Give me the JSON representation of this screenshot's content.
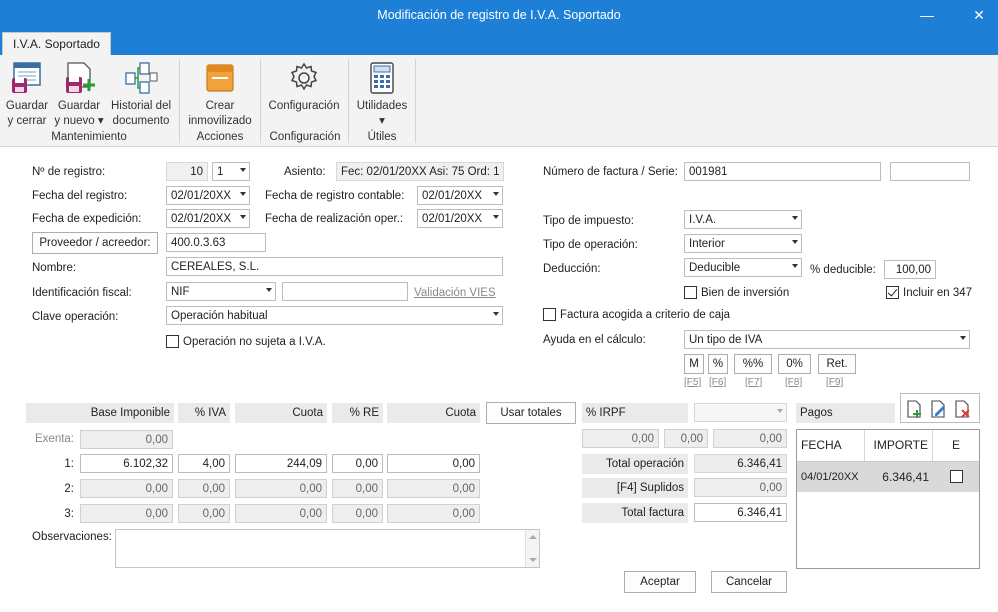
{
  "window": {
    "title": "Modificación de registro de I.V.A. Soportado"
  },
  "tab": {
    "label": "I.V.A. Soportado"
  },
  "ribbon": {
    "buttons": [
      {
        "label1": "Guardar",
        "label2": "y cerrar"
      },
      {
        "label1": "Guardar",
        "label2": "y nuevo ▾"
      },
      {
        "label1": "Historial del",
        "label2": "documento"
      },
      {
        "label1": "Crear",
        "label2": "inmovilizado"
      },
      {
        "label1": "Configuración",
        "label2": ""
      },
      {
        "label1": "Utilidades",
        "label2": "▾"
      }
    ],
    "groups": [
      "Mantenimiento",
      "Acciones",
      "Configuración",
      "Útiles"
    ]
  },
  "form": {
    "num_registro_label": "Nº de registro:",
    "num_registro_value": "10",
    "num_registro_sub": "1",
    "asiento_label": "Asiento:",
    "asiento_value": "Fec: 02/01/20XX Asi: 75 Ord: 1",
    "fecha_registro_label": "Fecha del registro:",
    "fecha_registro_value": "02/01/20XX",
    "fecha_contable_label": "Fecha de registro contable:",
    "fecha_contable_value": "02/01/20XX",
    "fecha_expedicion_label": "Fecha de expedición:",
    "fecha_expedicion_value": "02/01/20XX",
    "fecha_realizacion_label": "Fecha de realización oper.:",
    "fecha_realizacion_value": "02/01/20XX",
    "proveedor_button": "Proveedor / acreedor:",
    "proveedor_value": "400.0.3.63",
    "nombre_label": "Nombre:",
    "nombre_value": "CEREALES, S.L.",
    "identificacion_label": "Identificación fiscal:",
    "identificacion_tipo": "NIF",
    "identificacion_value": "",
    "validacion_link": "Validación VIES",
    "clave_label": "Clave operación:",
    "clave_value": "Operación habitual",
    "no_sujeta_label": "Operación no sujeta a I.V.A.",
    "num_factura_label": "Número de factura / Serie:",
    "num_factura_value": "001981",
    "serie_value": "",
    "tipo_impuesto_label": "Tipo de impuesto:",
    "tipo_impuesto_value": "I.V.A.",
    "tipo_operacion_label": "Tipo de operación:",
    "tipo_operacion_value": "Interior",
    "deduccion_label": "Deducción:",
    "deduccion_value": "Deducible",
    "pct_deducible_label": "% deducible:",
    "pct_deducible_value": "100,00",
    "bien_inversion_label": "Bien de inversión",
    "incluir_347_label": "Incluir en 347",
    "criterio_caja_label": "Factura acogida a criterio de caja",
    "ayuda_label": "Ayuda en el cálculo:",
    "ayuda_value": "Un tipo de IVA",
    "calc_buttons": [
      "M",
      "%",
      "%%",
      "0%",
      "Ret."
    ],
    "calc_keys": [
      "[F5]",
      "[F6]",
      "[F7]",
      "[F8]",
      "[F9]"
    ]
  },
  "grid": {
    "headers": [
      "Base Imponible",
      "% IVA",
      "Cuota",
      "% RE",
      "Cuota"
    ],
    "usar_totales": "Usar totales",
    "exenta_label": "Exenta:",
    "exenta_value": "0,00",
    "rows": [
      {
        "label": "1:",
        "base": "6.102,32",
        "iva": "4,00",
        "cuota": "244,09",
        "re": "0,00",
        "cuota_re": "0,00"
      },
      {
        "label": "2:",
        "base": "0,00",
        "iva": "0,00",
        "cuota": "0,00",
        "re": "0,00",
        "cuota_re": "0,00"
      },
      {
        "label": "3:",
        "base": "0,00",
        "iva": "0,00",
        "cuota": "0,00",
        "re": "0,00",
        "cuota_re": "0,00"
      }
    ],
    "observaciones_label": "Observaciones:"
  },
  "irpf": {
    "label": "% IRPF",
    "select_value": "",
    "values": [
      "0,00",
      "0,00",
      "0,00"
    ]
  },
  "totals": {
    "total_operacion_label": "Total operación",
    "total_operacion_value": "6.346,41",
    "suplidos_label": "[F4] Suplidos",
    "suplidos_value": "0,00",
    "total_factura_label": "Total factura",
    "total_factura_value": "6.346,41"
  },
  "pagos": {
    "label": "Pagos",
    "columns": [
      "FECHA",
      "IMPORTE",
      "E"
    ],
    "rows": [
      {
        "fecha": "04/01/20XX",
        "importe": "6.346,41",
        "e": false
      }
    ]
  },
  "footer": {
    "aceptar": "Aceptar",
    "cancelar": "Cancelar"
  },
  "colors": {
    "titlebar": "#1d80d6",
    "ribbon": "#f3f3f3"
  }
}
